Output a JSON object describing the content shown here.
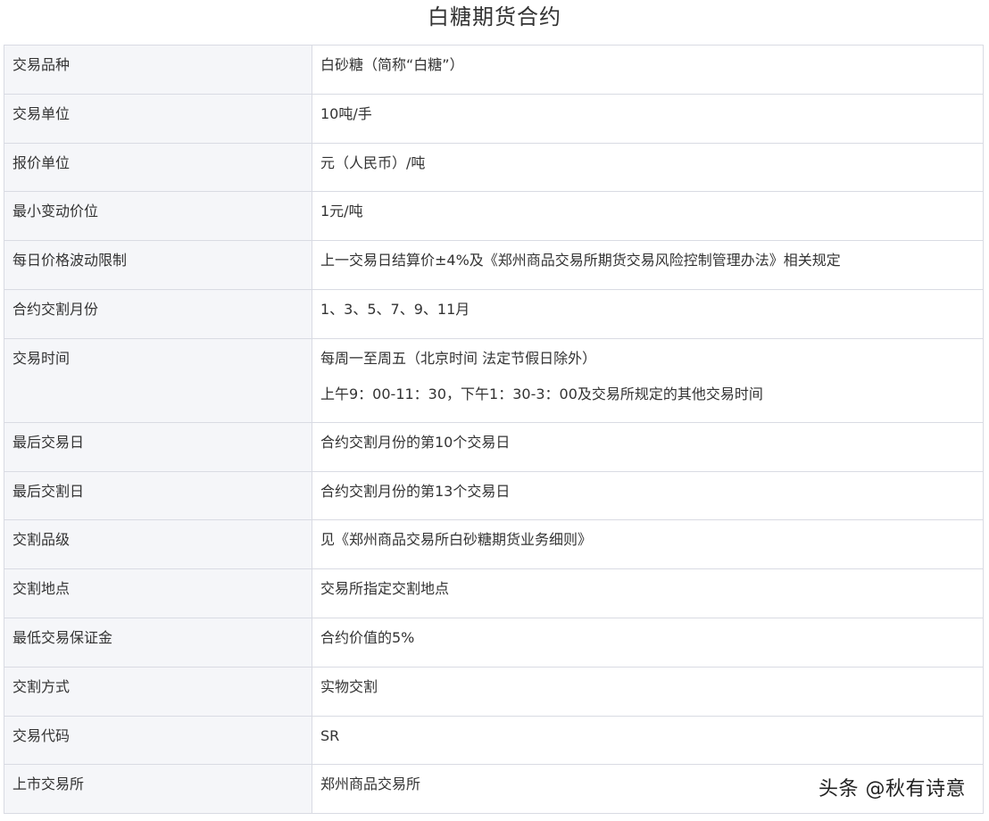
{
  "title": "白糖期货合约",
  "rows": [
    {
      "label": "交易品种",
      "value": [
        "白砂糖（简称“白糖”）"
      ]
    },
    {
      "label": "交易单位",
      "value": [
        "10吨/手"
      ]
    },
    {
      "label": "报价单位",
      "value": [
        "元（人民币）/吨"
      ]
    },
    {
      "label": "最小变动价位",
      "value": [
        "1元/吨"
      ]
    },
    {
      "label": "每日价格波动限制",
      "value": [
        "上一交易日结算价±4%及《郑州商品交易所期货交易风险控制管理办法》相关规定"
      ]
    },
    {
      "label": "合约交割月份",
      "value": [
        "1、3、5、7、9、11月"
      ]
    },
    {
      "label": "交易时间",
      "value": [
        "每周一至周五（北京时间 法定节假日除外）",
        "上午9：00-11：30，下午1：30-3：00及交易所规定的其他交易时间"
      ]
    },
    {
      "label": "最后交易日",
      "value": [
        "合约交割月份的第10个交易日"
      ]
    },
    {
      "label": "最后交割日",
      "value": [
        "合约交割月份的第13个交易日"
      ]
    },
    {
      "label": "交割品级",
      "value": [
        "见《郑州商品交易所白砂糖期货业务细则》"
      ]
    },
    {
      "label": "交割地点",
      "value": [
        "交易所指定交割地点"
      ]
    },
    {
      "label": "最低交易保证金",
      "value": [
        "合约价值的5%"
      ]
    },
    {
      "label": "交割方式",
      "value": [
        "实物交割"
      ]
    },
    {
      "label": "交易代码",
      "value": [
        "SR"
      ]
    },
    {
      "label": "上市交易所",
      "value": [
        "郑州商品交易所"
      ]
    }
  ],
  "watermark": "头条 @秋有诗意"
}
